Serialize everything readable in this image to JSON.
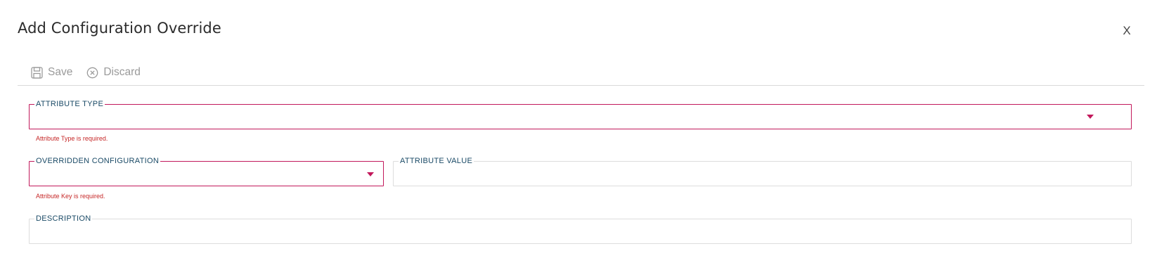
{
  "dialog": {
    "title": "Add Configuration Override",
    "close_label": "X"
  },
  "toolbar": {
    "save_label": "Save",
    "discard_label": "Discard"
  },
  "form": {
    "attribute_type": {
      "label": "ATTRIBUTE TYPE",
      "value": "",
      "error": "Attribute Type is required."
    },
    "overridden_configuration": {
      "label": "OVERRIDDEN CONFIGURATION",
      "value": "",
      "error": "Attribute Key is required."
    },
    "attribute_value": {
      "label": "ATTRIBUTE VALUE",
      "value": ""
    },
    "description": {
      "label": "DESCRIPTION",
      "value": ""
    }
  },
  "colors": {
    "error_border": "#c2185b",
    "error_text": "#c62828",
    "label_text": "#1a4a66",
    "toolbar_text": "#9a9a9a"
  },
  "icons": {
    "save": "floppy-disk-icon",
    "discard": "circle-x-icon",
    "dropdown": "caret-down-icon"
  }
}
